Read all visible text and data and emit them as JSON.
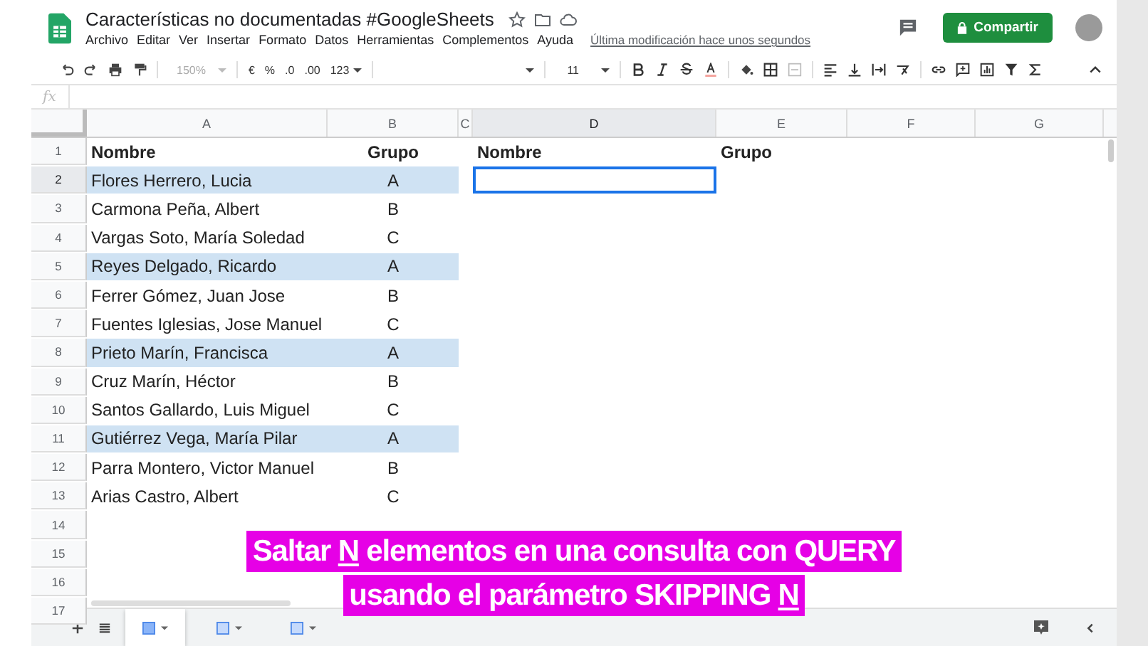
{
  "window": {
    "title": "Características no documentadas #GoogleSheets",
    "last_modified": "Última modificación hace unos segundos"
  },
  "menu": [
    "Archivo",
    "Editar",
    "Ver",
    "Insertar",
    "Formato",
    "Datos",
    "Herramientas",
    "Complementos",
    "Ayuda"
  ],
  "share_button": "Compartir",
  "toolbar": {
    "zoom": "150%",
    "currency": "€",
    "percent": "%",
    "decimal_less": ".0",
    "decimal_more": ".00",
    "number_format": "123",
    "font_size": "11"
  },
  "formula_bar": {
    "label": "fx"
  },
  "columns": [
    {
      "label": "A",
      "selected": false
    },
    {
      "label": "B",
      "selected": false
    },
    {
      "label": "C",
      "selected": false
    },
    {
      "label": "D",
      "selected": true
    },
    {
      "label": "E",
      "selected": false
    },
    {
      "label": "F",
      "selected": false
    },
    {
      "label": "G",
      "selected": false
    }
  ],
  "rows": [
    {
      "number": "1",
      "kind": "header",
      "selected": false,
      "highlighted": false,
      "cells": [
        "Nombre",
        "Grupo",
        null,
        "Nombre",
        "Grupo",
        null,
        null
      ]
    },
    {
      "number": "2",
      "kind": "data",
      "selected": true,
      "highlighted": true,
      "cells": [
        "Flores Herrero, Lucia",
        "A",
        null,
        null,
        null,
        null,
        null
      ]
    },
    {
      "number": "3",
      "kind": "data",
      "selected": false,
      "highlighted": false,
      "cells": [
        "Carmona Peña, Albert",
        "B",
        null,
        null,
        null,
        null,
        null
      ]
    },
    {
      "number": "4",
      "kind": "data",
      "selected": false,
      "highlighted": false,
      "cells": [
        "Vargas Soto, María Soledad",
        "C",
        null,
        null,
        null,
        null,
        null
      ]
    },
    {
      "number": "5",
      "kind": "data",
      "selected": false,
      "highlighted": true,
      "cells": [
        "Reyes Delgado, Ricardo",
        "A",
        null,
        null,
        null,
        null,
        null
      ]
    },
    {
      "number": "6",
      "kind": "data",
      "selected": false,
      "highlighted": false,
      "cells": [
        "Ferrer Gómez, Juan Jose",
        "B",
        null,
        null,
        null,
        null,
        null
      ]
    },
    {
      "number": "7",
      "kind": "data",
      "selected": false,
      "highlighted": false,
      "cells": [
        "Fuentes Iglesias, Jose Manuel",
        "C",
        null,
        null,
        null,
        null,
        null
      ]
    },
    {
      "number": "8",
      "kind": "data",
      "selected": false,
      "highlighted": true,
      "cells": [
        "Prieto Marín, Francisca",
        "A",
        null,
        null,
        null,
        null,
        null
      ]
    },
    {
      "number": "9",
      "kind": "data",
      "selected": false,
      "highlighted": false,
      "cells": [
        "Cruz Marín, Héctor",
        "B",
        null,
        null,
        null,
        null,
        null
      ]
    },
    {
      "number": "10",
      "kind": "data",
      "selected": false,
      "highlighted": false,
      "cells": [
        "Santos Gallardo, Luis Miguel",
        "C",
        null,
        null,
        null,
        null,
        null
      ]
    },
    {
      "number": "11",
      "kind": "data",
      "selected": false,
      "highlighted": true,
      "cells": [
        "Gutiérrez Vega, María Pilar",
        "A",
        null,
        null,
        null,
        null,
        null
      ]
    },
    {
      "number": "12",
      "kind": "data",
      "selected": false,
      "highlighted": false,
      "cells": [
        "Parra Montero, Victor Manuel",
        "B",
        null,
        null,
        null,
        null,
        null
      ]
    },
    {
      "number": "13",
      "kind": "data",
      "selected": false,
      "highlighted": false,
      "cells": [
        "Arias Castro, Albert",
        "C",
        null,
        null,
        null,
        null,
        null
      ]
    },
    {
      "number": "14",
      "selected": false,
      "highlighted": false
    },
    {
      "number": "15",
      "selected": false,
      "highlighted": false
    },
    {
      "number": "16",
      "selected": false,
      "highlighted": false
    },
    {
      "number": "17",
      "selected": false,
      "highlighted": false
    }
  ],
  "sheet_tabs": [
    {
      "selected": true
    },
    {
      "selected": false
    },
    {
      "selected": false
    }
  ],
  "caption": [
    [
      {
        "text": "Saltar ",
        "underlined": false
      },
      {
        "text": "N",
        "underlined": true
      },
      {
        "text": " elementos en una consulta con QUERY",
        "underlined": false
      }
    ],
    [
      {
        "text": "usando el parámetro SKIPPING ",
        "underlined": false
      },
      {
        "text": "N",
        "underlined": true
      }
    ]
  ]
}
